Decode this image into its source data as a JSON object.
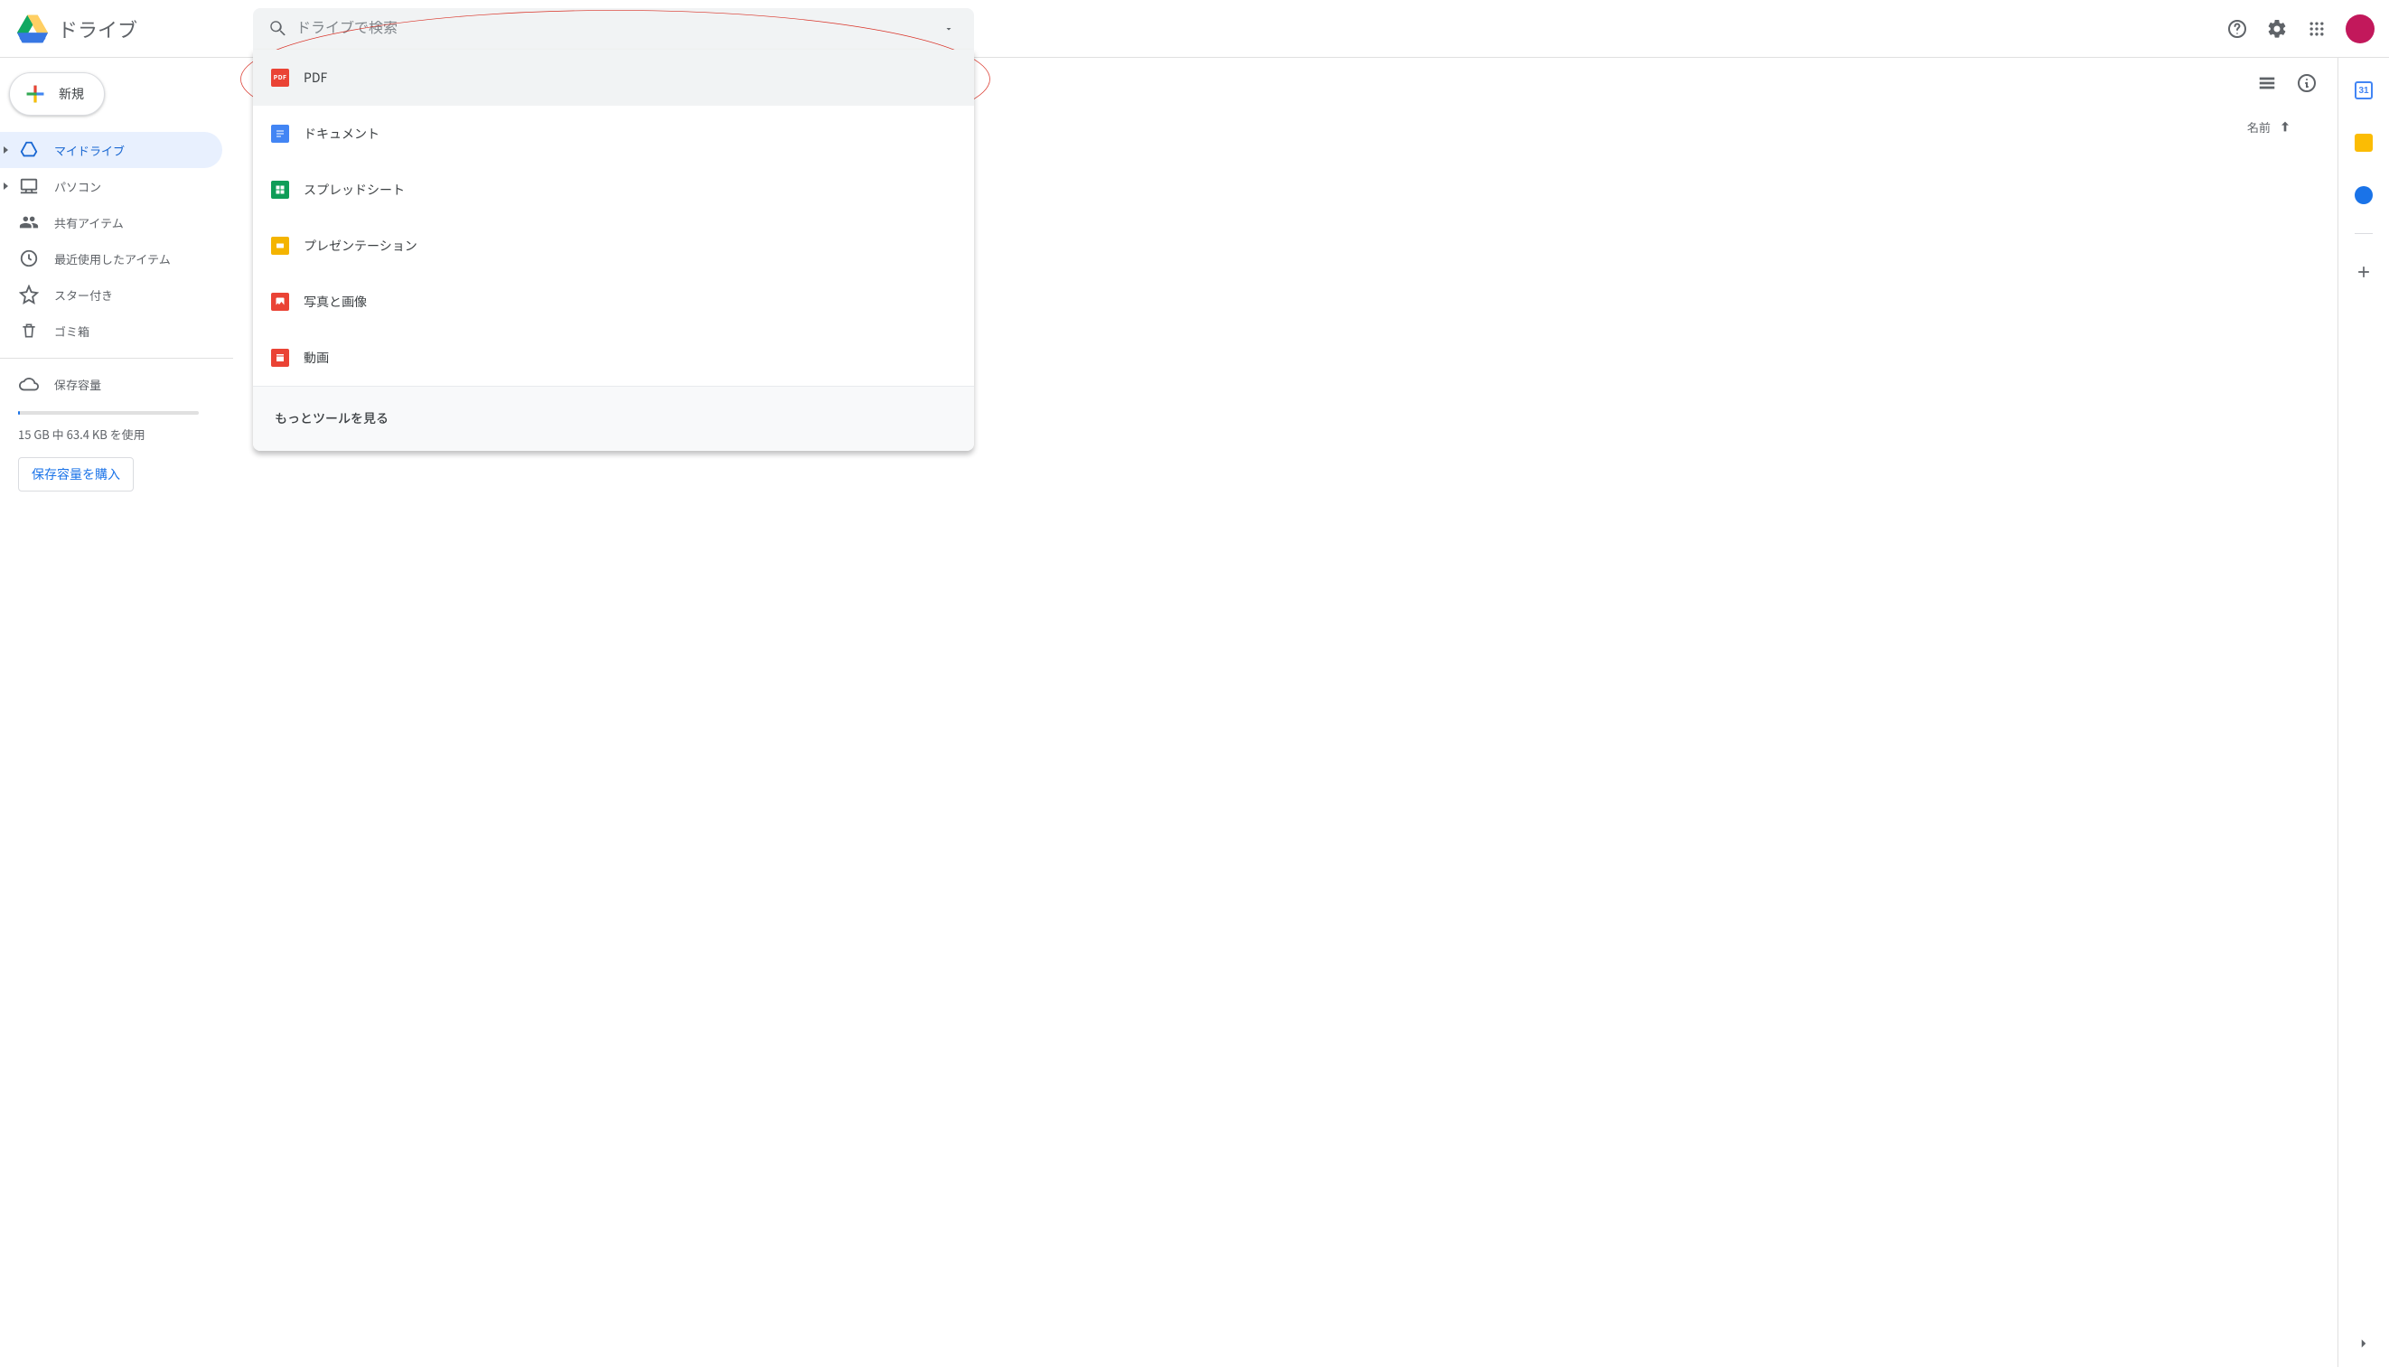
{
  "brand": {
    "title": "ドライブ"
  },
  "search": {
    "placeholder": "ドライブで検索",
    "value": ""
  },
  "suggestions": {
    "items": [
      {
        "label": "PDF",
        "icon": "pdf",
        "color": "#ea4335",
        "text": "PDF"
      },
      {
        "label": "ドキュメント",
        "icon": "doc",
        "color": "#4285f4",
        "text": ""
      },
      {
        "label": "スプレッドシート",
        "icon": "sheet",
        "color": "#0f9d58",
        "text": ""
      },
      {
        "label": "プレゼンテーション",
        "icon": "slides",
        "color": "#f4b400",
        "text": ""
      },
      {
        "label": "写真と画像",
        "icon": "image",
        "color": "#ea4335",
        "text": ""
      },
      {
        "label": "動画",
        "icon": "video",
        "color": "#ea4335",
        "text": ""
      }
    ],
    "footer": "もっとツールを見る"
  },
  "sidebar": {
    "new_label": "新規",
    "items": [
      {
        "label": "マイドライブ",
        "icon": "mydrive",
        "expandable": true,
        "active": true
      },
      {
        "label": "パソコン",
        "icon": "computer",
        "expandable": true,
        "active": false
      },
      {
        "label": "共有アイテム",
        "icon": "shared",
        "expandable": false,
        "active": false
      },
      {
        "label": "最近使用したアイテム",
        "icon": "recent",
        "expandable": false,
        "active": false
      },
      {
        "label": "スター付き",
        "icon": "star",
        "expandable": false,
        "active": false
      },
      {
        "label": "ゴミ箱",
        "icon": "trash",
        "expandable": false,
        "active": false
      }
    ],
    "storage_label": "保存容量",
    "storage_text": "15 GB 中 63.4 KB を使用",
    "buy_label": "保存容量を購入"
  },
  "main": {
    "sort_column": "名前"
  },
  "annotation": {
    "stroke": "#d93025"
  }
}
